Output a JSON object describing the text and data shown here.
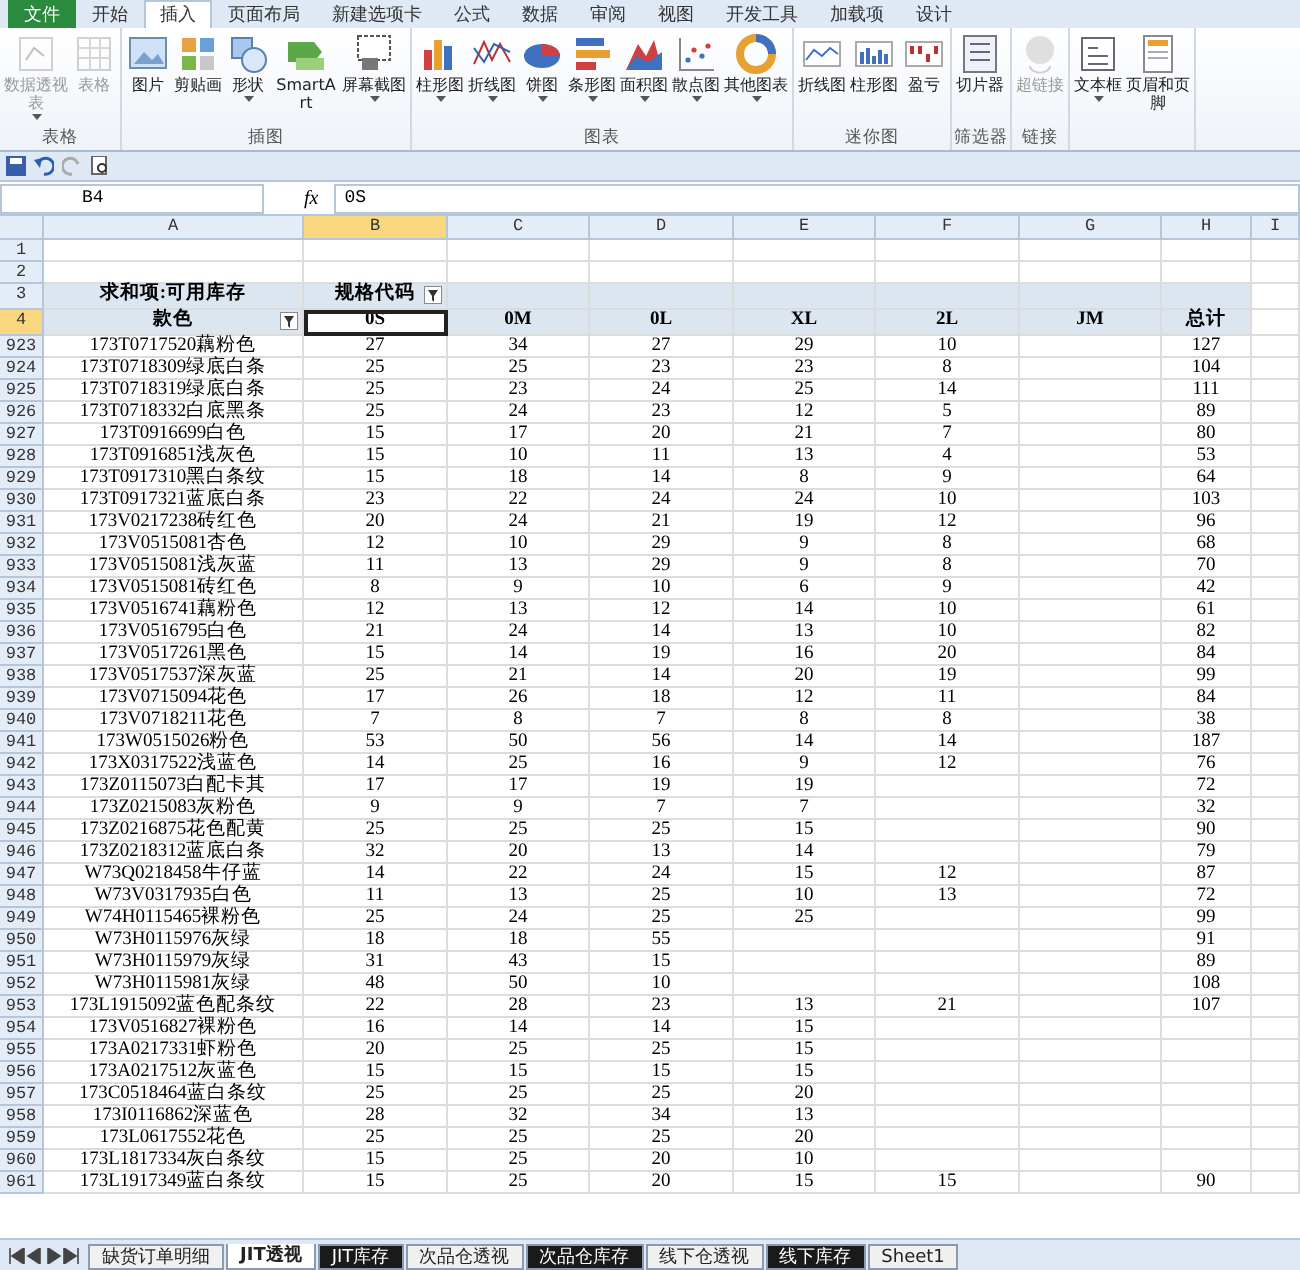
{
  "ribbon_tabs": [
    {
      "label": "文件",
      "selected": false
    },
    {
      "label": "开始",
      "selected": false
    },
    {
      "label": "插入",
      "selected": true
    },
    {
      "label": "页面布局",
      "selected": false
    },
    {
      "label": "新建选项卡",
      "selected": false
    },
    {
      "label": "公式",
      "selected": false
    },
    {
      "label": "数据",
      "selected": false
    },
    {
      "label": "审阅",
      "selected": false
    },
    {
      "label": "视图",
      "selected": false
    },
    {
      "label": "开发工具",
      "selected": false
    },
    {
      "label": "加载项",
      "selected": false
    },
    {
      "label": "设计",
      "selected": false
    }
  ],
  "ribbon_groups": [
    {
      "label": "表格",
      "buttons": [
        {
          "label": "数据透视表",
          "disabled": true,
          "dropdown": true
        },
        {
          "label": "表格",
          "disabled": true,
          "dropdown": false
        }
      ]
    },
    {
      "label": "插图",
      "buttons": [
        {
          "label": "图片",
          "disabled": false,
          "dropdown": false
        },
        {
          "label": "剪贴画",
          "disabled": false,
          "dropdown": false
        },
        {
          "label": "形状",
          "disabled": false,
          "dropdown": true
        },
        {
          "label": "SmartArt",
          "disabled": false,
          "dropdown": false
        },
        {
          "label": "屏幕截图",
          "disabled": false,
          "dropdown": true
        }
      ]
    },
    {
      "label": "图表",
      "buttons": [
        {
          "label": "柱形图",
          "disabled": false,
          "dropdown": true
        },
        {
          "label": "折线图",
          "disabled": false,
          "dropdown": true
        },
        {
          "label": "饼图",
          "disabled": false,
          "dropdown": true
        },
        {
          "label": "条形图",
          "disabled": false,
          "dropdown": true
        },
        {
          "label": "面积图",
          "disabled": false,
          "dropdown": true
        },
        {
          "label": "散点图",
          "disabled": false,
          "dropdown": true
        },
        {
          "label": "其他图表",
          "disabled": false,
          "dropdown": true
        }
      ]
    },
    {
      "label": "迷你图",
      "buttons": [
        {
          "label": "折线图",
          "disabled": false,
          "dropdown": false
        },
        {
          "label": "柱形图",
          "disabled": false,
          "dropdown": false
        },
        {
          "label": "盈亏",
          "disabled": false,
          "dropdown": false
        }
      ]
    },
    {
      "label": "筛选器",
      "buttons": [
        {
          "label": "切片器",
          "disabled": false,
          "dropdown": false
        }
      ]
    },
    {
      "label": "链接",
      "buttons": [
        {
          "label": "超链接",
          "disabled": true,
          "dropdown": false
        }
      ]
    },
    {
      "buttons": [
        {
          "label": "文本框",
          "disabled": false,
          "dropdown": true
        },
        {
          "label": "页眉和页脚",
          "disabled": false,
          "dropdown": false
        }
      ]
    }
  ],
  "name_box": "B4",
  "function_button": "fx",
  "formula": "0S",
  "columns": [
    {
      "label": "A",
      "selected": false
    },
    {
      "label": "B",
      "selected": true
    },
    {
      "label": "C",
      "selected": false
    },
    {
      "label": "D",
      "selected": false
    },
    {
      "label": "E",
      "selected": false
    },
    {
      "label": "F",
      "selected": false
    },
    {
      "label": "G",
      "selected": false
    },
    {
      "label": "H",
      "selected": false
    },
    {
      "label": "I",
      "selected": false
    }
  ],
  "top_rows": [
    {
      "n": "1",
      "selected": false
    },
    {
      "n": "2",
      "selected": false
    },
    {
      "n": "3",
      "selected": false
    },
    {
      "n": "4",
      "selected": true
    }
  ],
  "pivot": {
    "value_field": "求和项:可用库存",
    "column_field": "规格代码",
    "row_field": "款色",
    "sizes": [
      "0S",
      "0M",
      "0L",
      "XL",
      "2L",
      "JM"
    ],
    "total": "总计"
  },
  "rows": [
    {
      "n": "923",
      "item": "173T0717520藕粉色",
      "os": "27",
      "om": "34",
      "ol": "27",
      "xl": "29",
      "l2": "10",
      "total": "127"
    },
    {
      "n": "924",
      "item": "173T0718309绿底白条",
      "os": "25",
      "om": "25",
      "ol": "23",
      "xl": "23",
      "l2": "8",
      "total": "104"
    },
    {
      "n": "925",
      "item": "173T0718319绿底白条",
      "os": "25",
      "om": "23",
      "ol": "24",
      "xl": "25",
      "l2": "14",
      "total": "111"
    },
    {
      "n": "926",
      "item": "173T0718332白底黑条",
      "os": "25",
      "om": "24",
      "ol": "23",
      "xl": "12",
      "l2": "5",
      "total": "89"
    },
    {
      "n": "927",
      "item": "173T0916699白色",
      "os": "15",
      "om": "17",
      "ol": "20",
      "xl": "21",
      "l2": "7",
      "total": "80"
    },
    {
      "n": "928",
      "item": "173T0916851浅灰色",
      "os": "15",
      "om": "10",
      "ol": "11",
      "xl": "13",
      "l2": "4",
      "total": "53"
    },
    {
      "n": "929",
      "item": "173T0917310黑白条纹",
      "os": "15",
      "om": "18",
      "ol": "14",
      "xl": "8",
      "l2": "9",
      "total": "64"
    },
    {
      "n": "930",
      "item": "173T0917321蓝底白条",
      "os": "23",
      "om": "22",
      "ol": "24",
      "xl": "24",
      "l2": "10",
      "total": "103"
    },
    {
      "n": "931",
      "item": "173V0217238砖红色",
      "os": "20",
      "om": "24",
      "ol": "21",
      "xl": "19",
      "l2": "12",
      "total": "96"
    },
    {
      "n": "932",
      "item": "173V0515081杏色",
      "os": "12",
      "om": "10",
      "ol": "29",
      "xl": "9",
      "l2": "8",
      "total": "68"
    },
    {
      "n": "933",
      "item": "173V0515081浅灰蓝",
      "os": "11",
      "om": "13",
      "ol": "29",
      "xl": "9",
      "l2": "8",
      "total": "70"
    },
    {
      "n": "934",
      "item": "173V0515081砖红色",
      "os": "8",
      "om": "9",
      "ol": "10",
      "xl": "6",
      "l2": "9",
      "total": "42"
    },
    {
      "n": "935",
      "item": "173V0516741藕粉色",
      "os": "12",
      "om": "13",
      "ol": "12",
      "xl": "14",
      "l2": "10",
      "total": "61"
    },
    {
      "n": "936",
      "item": "173V0516795白色",
      "os": "21",
      "om": "24",
      "ol": "14",
      "xl": "13",
      "l2": "10",
      "total": "82"
    },
    {
      "n": "937",
      "item": "173V0517261黑色",
      "os": "15",
      "om": "14",
      "ol": "19",
      "xl": "16",
      "l2": "20",
      "total": "84"
    },
    {
      "n": "938",
      "item": "173V0517537深灰蓝",
      "os": "25",
      "om": "21",
      "ol": "14",
      "xl": "20",
      "l2": "19",
      "total": "99"
    },
    {
      "n": "939",
      "item": "173V0715094花色",
      "os": "17",
      "om": "26",
      "ol": "18",
      "xl": "12",
      "l2": "11",
      "total": "84"
    },
    {
      "n": "940",
      "item": "173V0718211花色",
      "os": "7",
      "om": "8",
      "ol": "7",
      "xl": "8",
      "l2": "8",
      "total": "38"
    },
    {
      "n": "941",
      "item": "173W0515026粉色",
      "os": "53",
      "om": "50",
      "ol": "56",
      "xl": "14",
      "l2": "14",
      "total": "187"
    },
    {
      "n": "942",
      "item": "173X0317522浅蓝色",
      "os": "14",
      "om": "25",
      "ol": "16",
      "xl": "9",
      "l2": "12",
      "total": "76"
    },
    {
      "n": "943",
      "item": "173Z0115073白配卡其",
      "os": "17",
      "om": "17",
      "ol": "19",
      "xl": "19",
      "total": "72"
    },
    {
      "n": "944",
      "item": "173Z0215083灰粉色",
      "os": "9",
      "om": "9",
      "ol": "7",
      "xl": "7",
      "total": "32"
    },
    {
      "n": "945",
      "item": "173Z0216875花色配黄",
      "os": "25",
      "om": "25",
      "ol": "25",
      "xl": "15",
      "total": "90"
    },
    {
      "n": "946",
      "item": "173Z0218312蓝底白条",
      "os": "32",
      "om": "20",
      "ol": "13",
      "xl": "14",
      "total": "79"
    },
    {
      "n": "947",
      "item": "W73Q0218458牛仔蓝",
      "os": "14",
      "om": "22",
      "ol": "24",
      "xl": "15",
      "l2": "12",
      "total": "87"
    },
    {
      "n": "948",
      "item": "W73V0317935白色",
      "os": "11",
      "om": "13",
      "ol": "25",
      "xl": "10",
      "l2": "13",
      "total": "72"
    },
    {
      "n": "949",
      "item": "W74H0115465裸粉色",
      "os": "25",
      "om": "24",
      "ol": "25",
      "xl": "25",
      "total": "99"
    },
    {
      "n": "950",
      "item": "W73H0115976灰绿",
      "os": "18",
      "om": "18",
      "ol": "55",
      "total": "91"
    },
    {
      "n": "951",
      "item": "W73H0115979灰绿",
      "os": "31",
      "om": "43",
      "ol": "15",
      "total": "89"
    },
    {
      "n": "952",
      "item": "W73H0115981灰绿",
      "os": "48",
      "om": "50",
      "ol": "10",
      "total": "108"
    },
    {
      "n": "953",
      "item": "173L1915092蓝色配条纹",
      "os": "22",
      "om": "28",
      "ol": "23",
      "xl": "13",
      "l2": "21",
      "total": "107"
    },
    {
      "n": "954",
      "item": "173V0516827裸粉色",
      "os": "16",
      "om": "14",
      "ol": "14",
      "xl": "15"
    },
    {
      "n": "955",
      "item": "173A0217331虾粉色",
      "os": "20",
      "om": "25",
      "ol": "25",
      "xl": "15"
    },
    {
      "n": "956",
      "item": "173A0217512灰蓝色",
      "os": "15",
      "om": "15",
      "ol": "15",
      "xl": "15"
    },
    {
      "n": "957",
      "item": "173C0518464蓝白条纹",
      "os": "25",
      "om": "25",
      "ol": "25",
      "xl": "20"
    },
    {
      "n": "958",
      "item": "173I0116862深蓝色",
      "os": "28",
      "om": "32",
      "ol": "34",
      "xl": "13"
    },
    {
      "n": "959",
      "item": "173L0617552花色",
      "os": "25",
      "om": "25",
      "ol": "25",
      "xl": "20"
    },
    {
      "n": "960",
      "item": "173L1817334灰白条纹",
      "os": "15",
      "om": "25",
      "ol": "20",
      "xl": "10"
    },
    {
      "n": "961",
      "item": "173L1917349蓝白条纹",
      "os": "15",
      "om": "25",
      "ol": "20",
      "xl": "15",
      "l2": "15",
      "total": "90"
    }
  ],
  "sheet_tabs": [
    {
      "label": "缺货订单明细",
      "selected": false,
      "color": "#f0f0f0"
    },
    {
      "label": "JIT透视",
      "selected": true,
      "color": "#ffffff"
    },
    {
      "label": "JIT库存",
      "selected": false,
      "color": "#1a1a1a"
    },
    {
      "label": "次品仓透视",
      "selected": false,
      "color": "#f0f0f0"
    },
    {
      "label": "次品仓库存",
      "selected": false,
      "color": "#1a1a1a"
    },
    {
      "label": "线下仓透视",
      "selected": false,
      "color": "#f0f0f0"
    },
    {
      "label": "线下库存",
      "selected": false,
      "color": "#1a1a1a"
    },
    {
      "label": "Sheet1",
      "selected": false,
      "color": "#f0f0f0"
    }
  ]
}
